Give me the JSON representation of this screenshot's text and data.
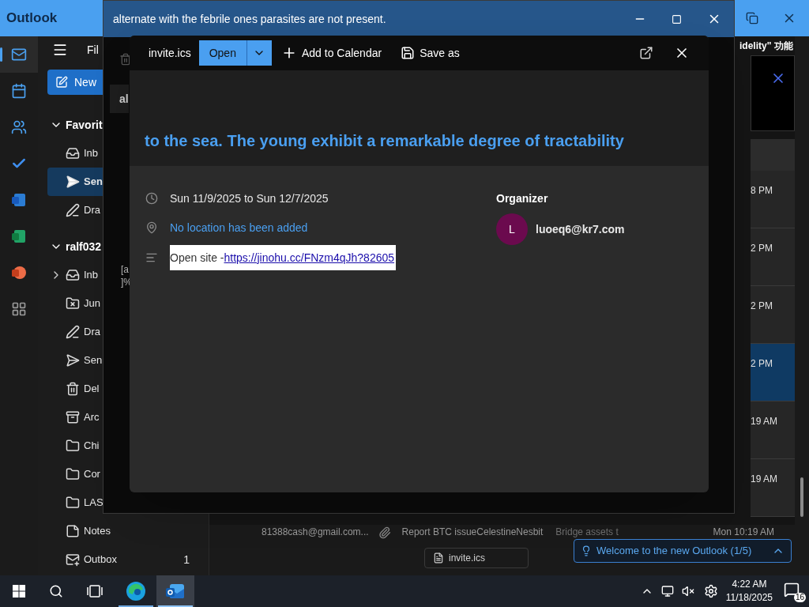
{
  "app": {
    "title": "Outlook"
  },
  "rail": [
    {
      "kind": "mail",
      "selected": true
    },
    {
      "kind": "calendar",
      "selected": false
    },
    {
      "kind": "people",
      "selected": false
    },
    {
      "kind": "todo",
      "selected": false
    },
    {
      "kind": "word",
      "selected": false
    },
    {
      "kind": "excel",
      "selected": false
    },
    {
      "kind": "powerpoint",
      "selected": false
    },
    {
      "kind": "apps",
      "selected": false
    }
  ],
  "folder_pane": {
    "menu_label": "Fil",
    "new_button": "New",
    "sections": [
      {
        "name": "Favorit",
        "expanded": true,
        "folders": [
          {
            "name": "Inb",
            "kind": "inbox",
            "selected": false,
            "expandable": false
          },
          {
            "name": "Sen",
            "kind": "send",
            "selected": true,
            "expandable": false
          },
          {
            "name": "Dra",
            "kind": "draft",
            "selected": false,
            "expandable": false
          }
        ]
      },
      {
        "name": "ralf032",
        "expanded": true,
        "folders": [
          {
            "name": "Inb",
            "kind": "inbox",
            "selected": false,
            "expandable": true
          },
          {
            "name": "Jun",
            "kind": "junk",
            "selected": false,
            "expandable": false
          },
          {
            "name": "Dra",
            "kind": "draft",
            "selected": false,
            "expandable": false
          },
          {
            "name": "Sen",
            "kind": "sent",
            "selected": false,
            "expandable": false
          },
          {
            "name": "Del",
            "kind": "trash",
            "selected": false,
            "expandable": false
          },
          {
            "name": "Arc",
            "kind": "archive",
            "selected": false,
            "expandable": false
          },
          {
            "name": "Chi",
            "kind": "folder",
            "selected": false,
            "expandable": false
          },
          {
            "name": "Cor",
            "kind": "folder",
            "selected": false,
            "expandable": false
          },
          {
            "name": "LAS",
            "kind": "folder",
            "selected": false,
            "expandable": false
          },
          {
            "name": "Notes",
            "kind": "note",
            "selected": false,
            "expandable": false
          },
          {
            "name": "Outbox",
            "kind": "outbox",
            "selected": false,
            "expandable": false,
            "count": "1"
          }
        ]
      }
    ]
  },
  "message_list": {
    "banner": "idelity\" 功能",
    "rows": [
      {
        "time": "8 PM",
        "selected": false
      },
      {
        "time": "2 PM",
        "selected": false
      },
      {
        "time": "2 PM",
        "selected": false
      },
      {
        "time": "2 PM",
        "selected": true
      },
      {
        "time": "19 AM",
        "selected": false
      },
      {
        "time": "19 AM",
        "selected": false
      }
    ],
    "bottom_row": {
      "sender": "81388cash@gmail.com...",
      "subject": "Report BTC issueCelestineNesbit",
      "preview": "Bridge assets t",
      "time": "Mon 10:19 AM",
      "attachment": "invite.ics"
    }
  },
  "message_window": {
    "title": "alternate with the febrile ones parasites are not present.",
    "fragments": [
      "al",
      "[a",
      "]%"
    ]
  },
  "preview_dialog": {
    "file_name": "invite.ics",
    "open_button": "Open",
    "actions": [
      {
        "kind": "add",
        "label": "Add to Calendar"
      },
      {
        "kind": "save",
        "label": "Save as"
      }
    ],
    "subject": "to the sea. The young exhibit a remarkable degree of tractability",
    "when": "Sun 11/9/2025 to Sun 12/7/2025",
    "location": "No location has been added",
    "notes_text": "Open site - ",
    "notes_link": "https://jinohu.cc/FNzm4qJh?82605",
    "organizer_heading": "Organizer",
    "organizer": {
      "initial": "L",
      "email": "luoeq6@kr7.com",
      "color": "#6b0a4e"
    }
  },
  "tip": {
    "text": "Welcome to the new Outlook (1/5)"
  },
  "taskbar": {
    "apps": [
      {
        "kind": "edge",
        "selected": false
      },
      {
        "kind": "outlook",
        "selected": true
      }
    ],
    "time": "4:22 AM",
    "date": "11/18/2025",
    "notifications": "16"
  }
}
